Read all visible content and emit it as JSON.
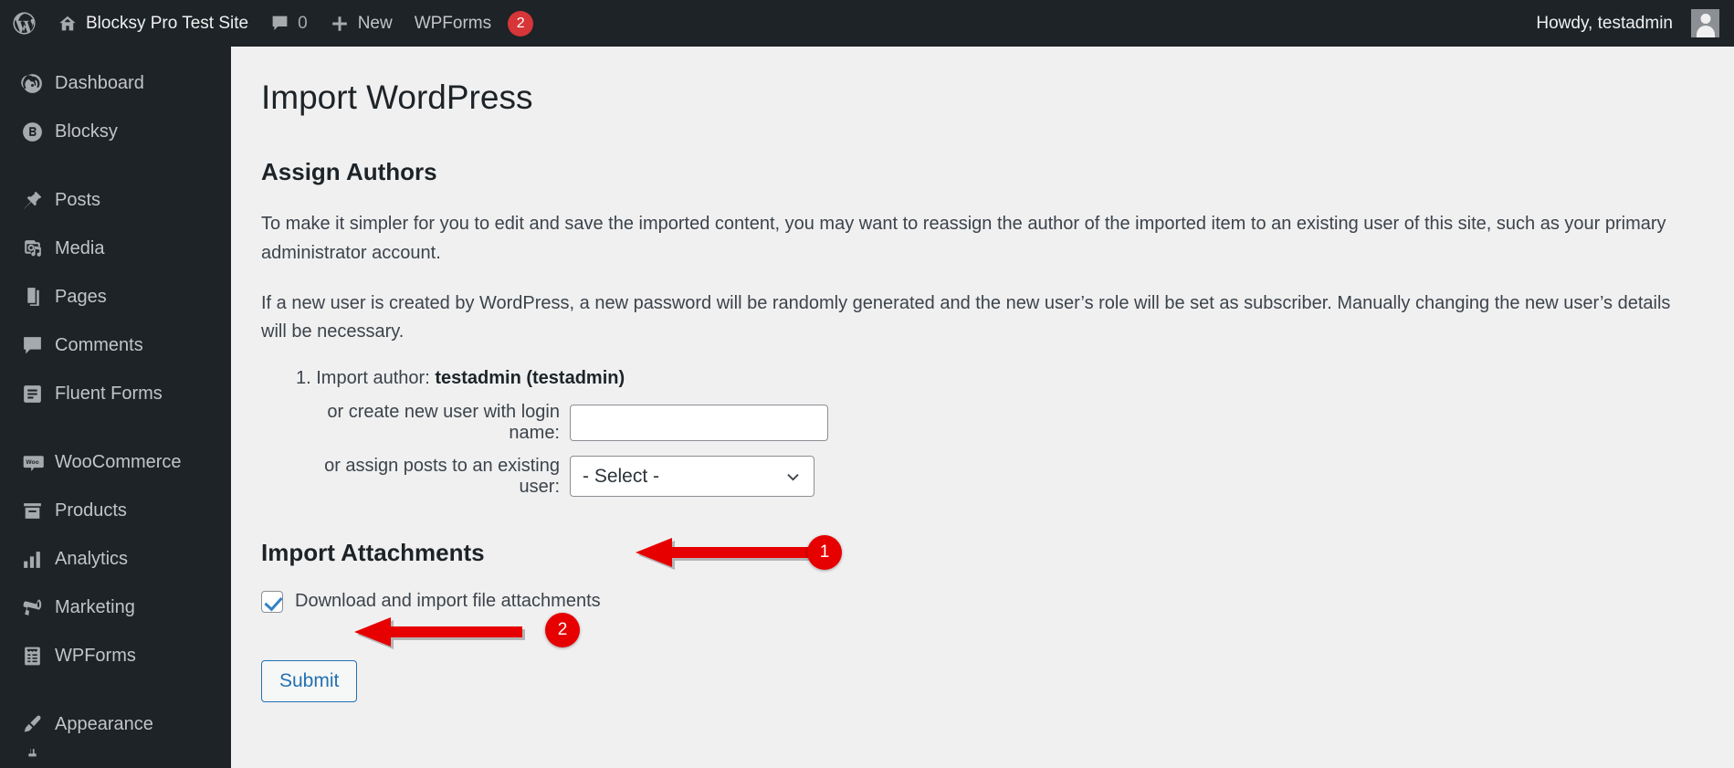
{
  "adminbar": {
    "wp_logo_icon": "wordpress-logo-icon",
    "home_icon": "home-icon",
    "site_name": "Blocksy Pro Test Site",
    "comments_icon": "comment-bubble-icon",
    "comments_count": "0",
    "new_icon": "plus-icon",
    "new_label": "New",
    "wpforms_label": "WPForms",
    "wpforms_badge": "2",
    "howdy": "Howdy, testadmin",
    "avatar_icon": "user-avatar-icon"
  },
  "sidebar": {
    "items": [
      {
        "label": "Dashboard",
        "icon": "dashboard-gauge-icon"
      },
      {
        "label": "Blocksy",
        "icon": "blocksy-logo-icon"
      },
      {
        "label": "Posts",
        "icon": "pushpin-icon"
      },
      {
        "label": "Media",
        "icon": "media-camera-music-icon"
      },
      {
        "label": "Pages",
        "icon": "pages-stack-icon"
      },
      {
        "label": "Comments",
        "icon": "comment-bubble-icon"
      },
      {
        "label": "Fluent Forms",
        "icon": "fluent-forms-icon"
      },
      {
        "label": "WooCommerce",
        "icon": "woocommerce-icon"
      },
      {
        "label": "Products",
        "icon": "products-box-icon"
      },
      {
        "label": "Analytics",
        "icon": "bar-chart-icon"
      },
      {
        "label": "Marketing",
        "icon": "megaphone-icon"
      },
      {
        "label": "WPForms",
        "icon": "wpforms-clipboard-icon"
      },
      {
        "label": "Appearance",
        "icon": "paintbrush-icon"
      }
    ]
  },
  "main": {
    "page_title": "Import WordPress",
    "assign_authors_title": "Assign Authors",
    "paragraph_1": "To make it simpler for you to edit and save the imported content, you may want to reassign the author of the imported item to an existing user of this site, such as your primary administrator account.",
    "paragraph_2": "If a new user is created by WordPress, a new password will be randomly generated and the new user’s role will be set as subscriber. Manually changing the new user’s details will be necessary.",
    "author": {
      "index": "1.",
      "import_author_label": "Import author:",
      "import_author_value": "testadmin (testadmin)",
      "new_user_label": "or create new user with login name:",
      "new_user_value": "",
      "new_user_placeholder": "",
      "existing_user_label": "or assign posts to an existing user:",
      "existing_user_selected": "- Select -",
      "existing_user_options": [
        "- Select -"
      ],
      "chevron_icon": "chevron-down-icon"
    },
    "import_attachments_title": "Import Attachments",
    "attachments_checkbox_label": "Download and import file attachments",
    "attachments_checkbox_checked": true,
    "submit_label": "Submit"
  },
  "annotations": {
    "color": "#e60000",
    "items": [
      {
        "badge": "1",
        "target": "attachments-checkbox-row"
      },
      {
        "badge": "2",
        "target": "submit-button"
      }
    ]
  }
}
